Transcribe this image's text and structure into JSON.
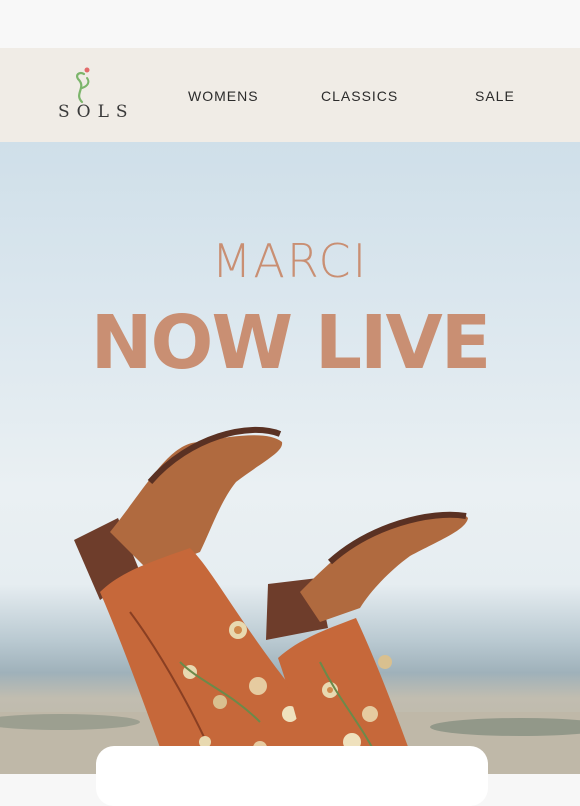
{
  "brand": {
    "logo_text": "SOLS"
  },
  "nav": {
    "links": [
      "WOMENS",
      "CLASSICS",
      "SALE"
    ]
  },
  "hero": {
    "subtitle": "MARCI",
    "title": "NOW LIVE",
    "image_desc": "embroidered-cowboy-boots"
  },
  "colors": {
    "accent": "#c98f73",
    "nav_bg": "#f0ece6"
  }
}
